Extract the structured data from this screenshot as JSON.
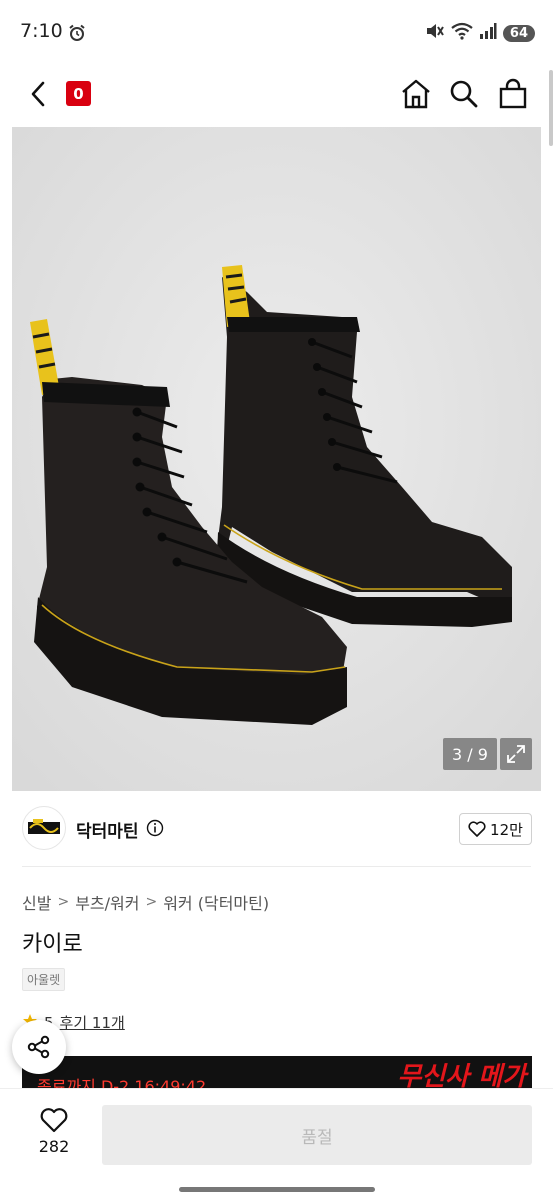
{
  "status_bar": {
    "time": "7:10",
    "battery": "64"
  },
  "nav": {
    "cart_count": "0"
  },
  "gallery": {
    "page_counter": "3 / 9"
  },
  "brand": {
    "name": "닥터마틴",
    "likes": "12만"
  },
  "breadcrumb": [
    "신발",
    "부츠/워커",
    "워커 (닥터마틴)"
  ],
  "product": {
    "title": "카이로",
    "tag": "아울렛",
    "rating": "5",
    "reviews_label": "후기 11개"
  },
  "promo": {
    "countdown": "종료까지 D-2 16:49:42",
    "art_text": "무신사 메가"
  },
  "bottom": {
    "wish_count": "282",
    "buy_label": "품절"
  },
  "colors": {
    "accent_red": "#d90010",
    "soldout_bg": "#ebebeb"
  }
}
